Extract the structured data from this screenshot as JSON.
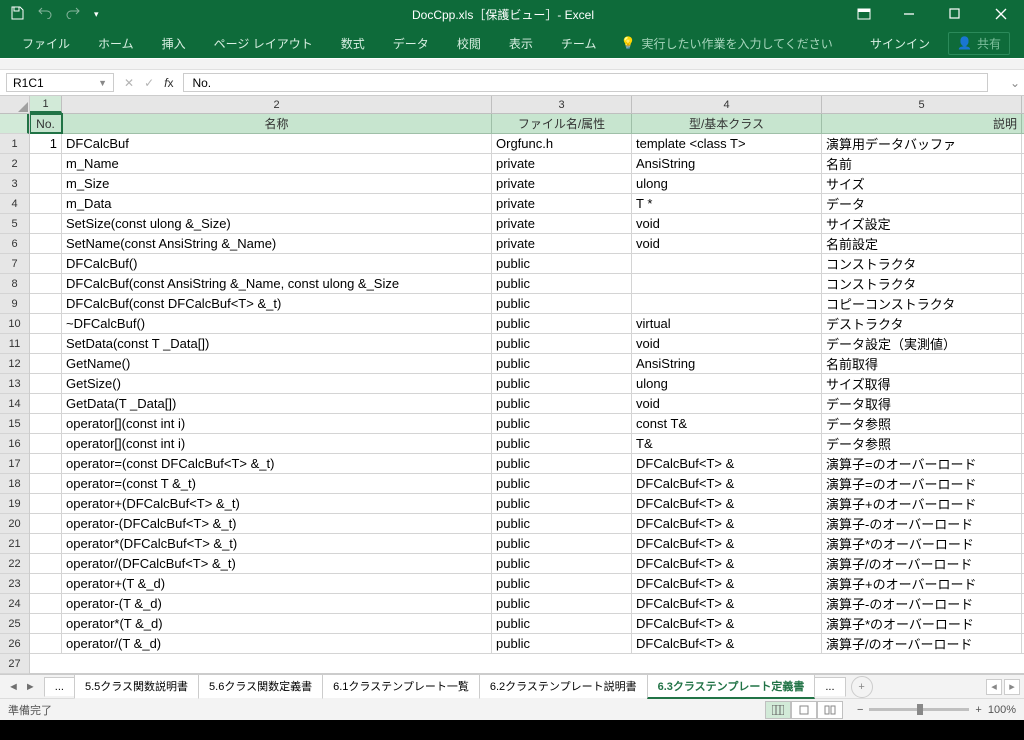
{
  "title": "DocCpp.xls［保護ビュー］- Excel",
  "ribbon": {
    "tabs": [
      "ファイル",
      "ホーム",
      "挿入",
      "ページ レイアウト",
      "数式",
      "データ",
      "校閲",
      "表示",
      "チーム"
    ],
    "tell": "実行したい作業を入力してください",
    "signin": "サインイン",
    "share": "共有"
  },
  "namebox": "R1C1",
  "fxvalue": "No.",
  "columns": [
    "1",
    "2",
    "3",
    "4",
    "5"
  ],
  "header_row": [
    "No.",
    "名称",
    "ファイル名/属性",
    "型/基本クラス",
    "説明"
  ],
  "rows": [
    {
      "n": "1",
      "a": "1",
      "b": "DFCalcBuf",
      "c": "Orgfunc.h",
      "d": "template <class T>",
      "e": "演算用データバッファ"
    },
    {
      "n": "2",
      "a": "",
      "b": "m_Name",
      "c": "private",
      "d": "AnsiString",
      "e": "名前"
    },
    {
      "n": "3",
      "a": "",
      "b": "m_Size",
      "c": "private",
      "d": "ulong",
      "e": "サイズ"
    },
    {
      "n": "4",
      "a": "",
      "b": "m_Data",
      "c": "private",
      "d": "T *",
      "e": "データ"
    },
    {
      "n": "5",
      "a": "",
      "b": "SetSize(const ulong &_Size)",
      "c": "private",
      "d": "void",
      "e": "サイズ設定"
    },
    {
      "n": "6",
      "a": "",
      "b": "SetName(const AnsiString &_Name)",
      "c": "private",
      "d": "void",
      "e": "名前設定"
    },
    {
      "n": "7",
      "a": "",
      "b": "DFCalcBuf()",
      "c": "public",
      "d": "",
      "e": "コンストラクタ"
    },
    {
      "n": "8",
      "a": "",
      "b": "DFCalcBuf(const AnsiString &_Name, const ulong &_Size",
      "c": "public",
      "d": "",
      "e": "コンストラクタ"
    },
    {
      "n": "9",
      "a": "",
      "b": "DFCalcBuf(const DFCalcBuf<T> &_t)",
      "c": "public",
      "d": "",
      "e": "コピーコンストラクタ"
    },
    {
      "n": "10",
      "a": "",
      "b": "~DFCalcBuf()",
      "c": "public",
      "d": "virtual",
      "e": "デストラクタ"
    },
    {
      "n": "11",
      "a": "",
      "b": "SetData(const T _Data[])",
      "c": "public",
      "d": "void",
      "e": "データ設定（実測値）"
    },
    {
      "n": "12",
      "a": "",
      "b": "GetName()",
      "c": "public",
      "d": "AnsiString",
      "e": "名前取得"
    },
    {
      "n": "13",
      "a": "",
      "b": "GetSize()",
      "c": "public",
      "d": "ulong",
      "e": "サイズ取得"
    },
    {
      "n": "14",
      "a": "",
      "b": "GetData(T _Data[])",
      "c": "public",
      "d": "void",
      "e": "データ取得"
    },
    {
      "n": "15",
      "a": "",
      "b": "operator[](const int i)",
      "c": "public",
      "d": "const T&",
      "e": "データ参照"
    },
    {
      "n": "16",
      "a": "",
      "b": "operator[](const int i)",
      "c": "public",
      "d": "T&",
      "e": "データ参照"
    },
    {
      "n": "17",
      "a": "",
      "b": "operator=(const DFCalcBuf<T> &_t)",
      "c": "public",
      "d": "DFCalcBuf<T> &",
      "e": "演算子=のオーバーロード"
    },
    {
      "n": "18",
      "a": "",
      "b": "operator=(const T &_t)",
      "c": "public",
      "d": "DFCalcBuf<T> &",
      "e": "演算子=のオーバーロード"
    },
    {
      "n": "19",
      "a": "",
      "b": "operator+(DFCalcBuf<T> &_t)",
      "c": "public",
      "d": "DFCalcBuf<T> &",
      "e": "演算子+のオーバーロード"
    },
    {
      "n": "20",
      "a": "",
      "b": "operator-(DFCalcBuf<T> &_t)",
      "c": "public",
      "d": "DFCalcBuf<T> &",
      "e": "演算子-のオーバーロード"
    },
    {
      "n": "21",
      "a": "",
      "b": "operator*(DFCalcBuf<T> &_t)",
      "c": "public",
      "d": "DFCalcBuf<T> &",
      "e": "演算子*のオーバーロード"
    },
    {
      "n": "22",
      "a": "",
      "b": "operator/(DFCalcBuf<T> &_t)",
      "c": "public",
      "d": "DFCalcBuf<T> &",
      "e": "演算子/のオーバーロード"
    },
    {
      "n": "23",
      "a": "",
      "b": "operator+(T &_d)",
      "c": "public",
      "d": "DFCalcBuf<T> &",
      "e": "演算子+のオーバーロード"
    },
    {
      "n": "24",
      "a": "",
      "b": "operator-(T &_d)",
      "c": "public",
      "d": "DFCalcBuf<T> &",
      "e": "演算子-のオーバーロード"
    },
    {
      "n": "25",
      "a": "",
      "b": "operator*(T &_d)",
      "c": "public",
      "d": "DFCalcBuf<T> &",
      "e": "演算子*のオーバーロード"
    },
    {
      "n": "26",
      "a": "",
      "b": "operator/(T &_d)",
      "c": "public",
      "d": "DFCalcBuf<T> &",
      "e": "演算子/のオーバーロード"
    }
  ],
  "sheets": {
    "overflow": "...",
    "list": [
      "5.5クラス関数説明書",
      "5.6クラス関数定義書",
      "6.1クラステンプレート一覧",
      "6.2クラステンプレート説明書",
      "6.3クラステンプレート定義書"
    ],
    "active": 4,
    "overflow2": "..."
  },
  "status": {
    "ready": "準備完了",
    "zoom": "100%"
  }
}
